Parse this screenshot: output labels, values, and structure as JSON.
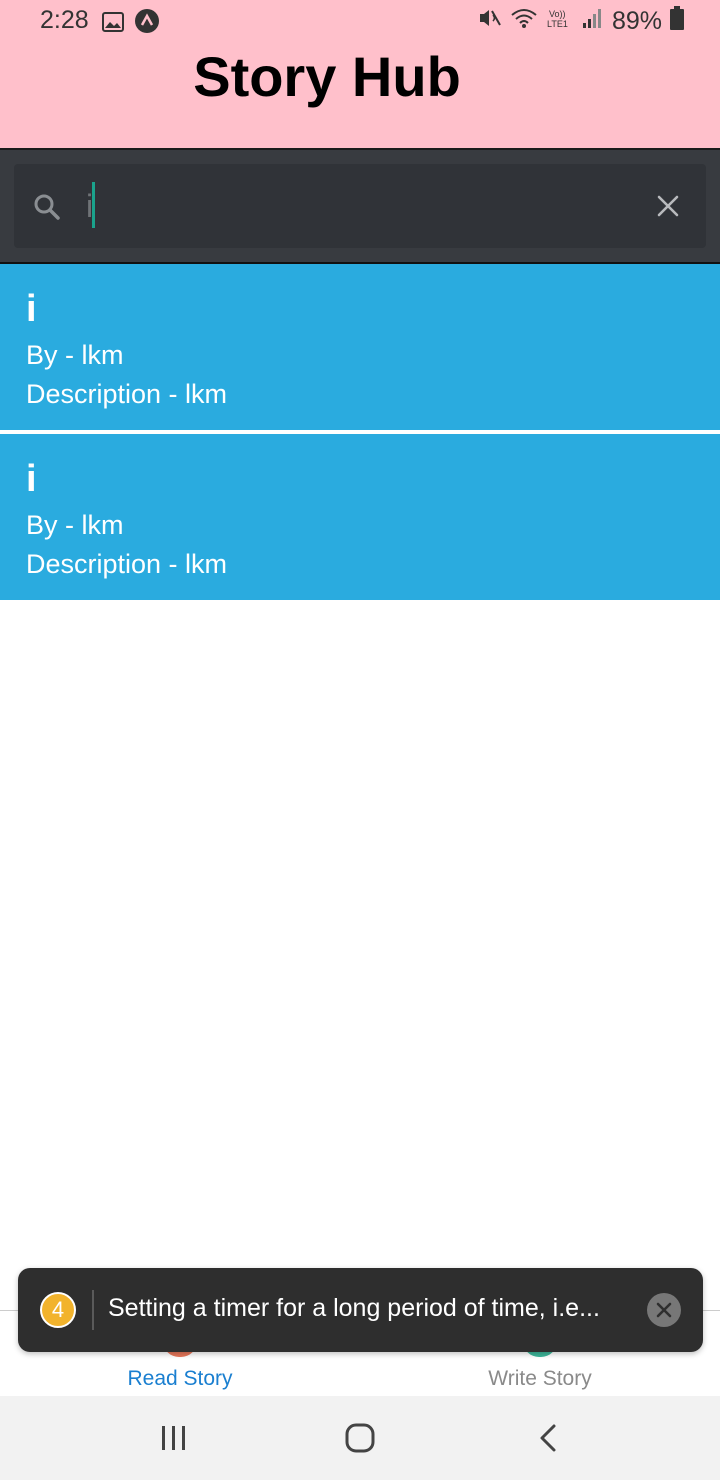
{
  "status_bar": {
    "time": "2:28",
    "battery": "89%",
    "left_icons": [
      "image-icon",
      "app-notification-icon"
    ],
    "right_icons": [
      "mute-icon",
      "wifi-icon",
      "volte-icon",
      "signal-icon",
      "battery-icon"
    ]
  },
  "header": {
    "title": "Story Hub",
    "background": "#ffc0cb"
  },
  "search": {
    "value": "i",
    "icon": "search-icon",
    "clear_icon": "close-icon"
  },
  "stories": [
    {
      "title": "i",
      "author": "By - lkm",
      "description": "Description - lkm"
    },
    {
      "title": "i",
      "author": "By - lkm",
      "description": "Description - lkm"
    }
  ],
  "story_card_color": "#2aabdf",
  "toast": {
    "count": "4",
    "message": "Setting a timer for a long period of time, i.e..."
  },
  "tabs": [
    {
      "label": "Read Story",
      "active": true,
      "color": "#1a7fd0"
    },
    {
      "label": "Write Story",
      "active": false,
      "color": "#8a8a8a"
    }
  ],
  "nav_bar": {
    "buttons": [
      "recents-icon",
      "home-icon",
      "back-icon"
    ]
  }
}
